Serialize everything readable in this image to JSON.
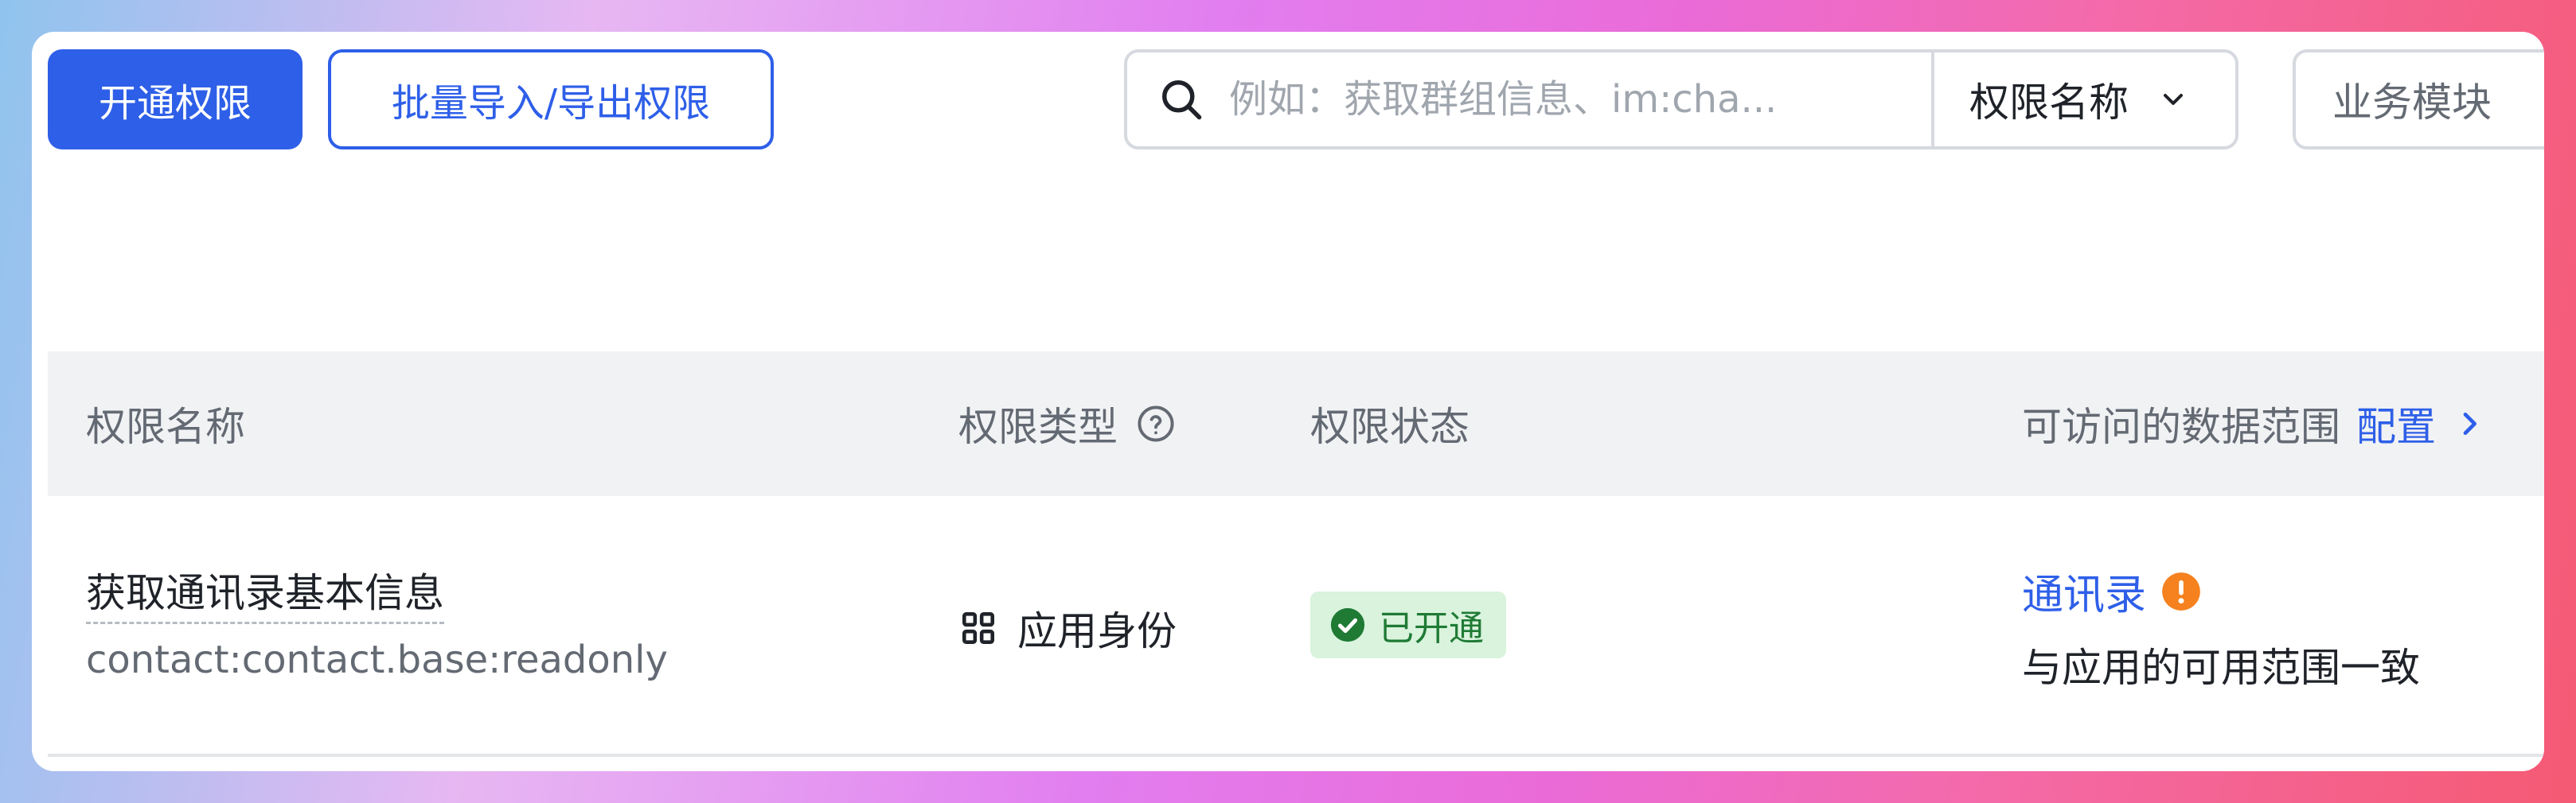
{
  "toolbar": {
    "enable_button": "开通权限",
    "batch_button": "批量导入/导出权限",
    "search_placeholder": "例如：获取群组信息、im:cha...",
    "filter_selected": "权限名称",
    "module_filter": "业务模块"
  },
  "table": {
    "headers": {
      "name": "权限名称",
      "type": "权限类型",
      "status": "权限状态",
      "scope": "可访问的数据范围",
      "scope_action": "配置"
    },
    "rows": [
      {
        "name": "获取通讯录基本信息",
        "code": "contact:contact.base:readonly",
        "type": "应用身份",
        "status": "已开通",
        "scope_link": "通讯录",
        "scope_desc": "与应用的可用范围一致"
      }
    ]
  },
  "colors": {
    "accent": "#2e5fe8",
    "status_bg": "#d9f3dd",
    "status_text": "#1f7a34",
    "warning": "#f5811f"
  },
  "icons": {
    "search": "search-icon",
    "filter_chevron": "chevron-down-icon",
    "help": "question-circle-icon",
    "config_chevron": "chevron-right-icon",
    "app_identity": "grid-icon",
    "status": "check-circle-icon",
    "warning": "exclamation-circle-icon"
  }
}
